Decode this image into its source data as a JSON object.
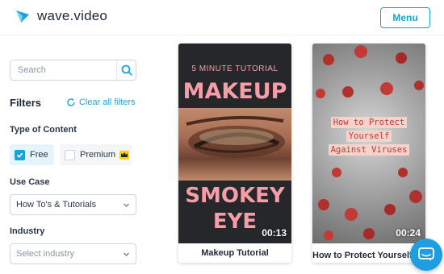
{
  "header": {
    "brand": "wave.video",
    "menu_label": "Menu",
    "accent_color": "#1aa3d9"
  },
  "sidebar": {
    "search_placeholder": "Search",
    "filters_title": "Filters",
    "clear_all_label": "Clear all filters",
    "type_of_content": {
      "label": "Type of Content",
      "options": [
        {
          "label": "Free",
          "checked": true
        },
        {
          "label": "Premium",
          "checked": false,
          "icon": "crown-icon"
        }
      ]
    },
    "use_case": {
      "label": "Use Case",
      "selected": "How To's & Tutorials"
    },
    "industry": {
      "label": "Industry",
      "placeholder": "Select industry"
    }
  },
  "cards": [
    {
      "title": "Makeup Tutorial",
      "duration": "00:13",
      "thumb_text": {
        "top": "5 MINUTE TUTORIAL",
        "line1": "MAKEUP",
        "line2": "SMOKEY",
        "line3": "EYE"
      }
    },
    {
      "title": "How to Protect Yourself Against Viruses",
      "duration": "00:24",
      "thumb_text": {
        "line1": "How to Protect",
        "line2": "Yourself",
        "line3": "Against Viruses"
      }
    }
  ],
  "chat": {
    "icon": "chat-icon"
  }
}
